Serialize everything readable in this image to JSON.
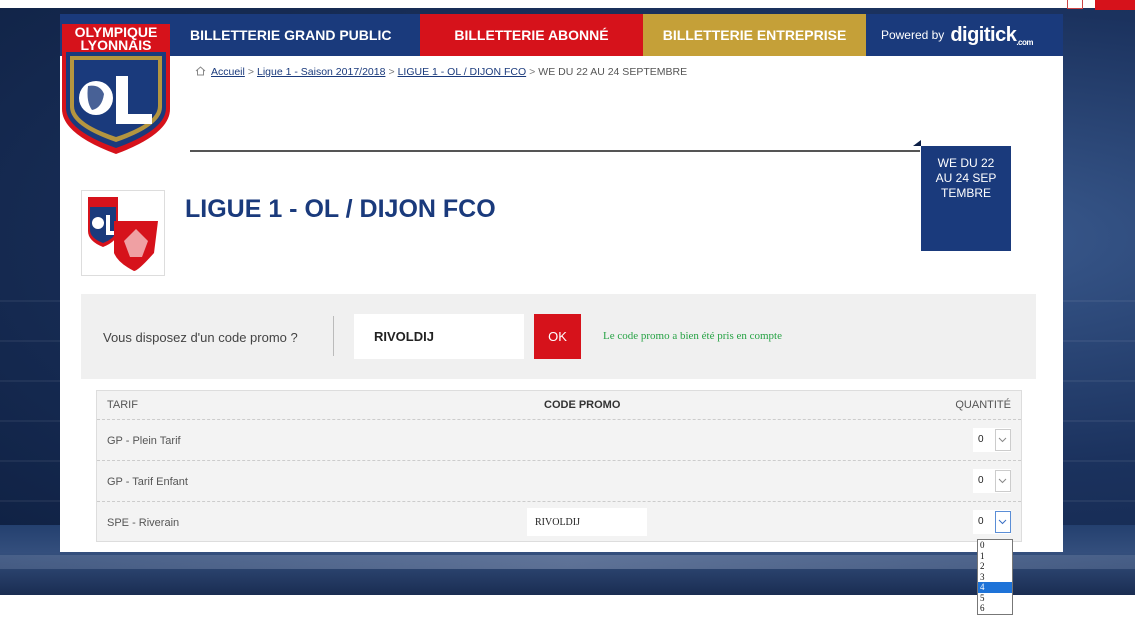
{
  "nav": {
    "tabs": [
      "BILLETTERIE GRAND PUBLIC",
      "BILLETTERIE ABONNÉ",
      "BILLETTERIE ENTREPRISE"
    ],
    "powered_by": "Powered by",
    "brand": "digitick",
    "brand_suffix": ".com"
  },
  "logo": {
    "line1": "OLYMPIQUE",
    "line2": "LYONNAIS"
  },
  "breadcrumb": {
    "items": [
      "Accueil",
      "Ligue 1 - Saison 2017/2018",
      "LIGUE 1 - OL / DIJON FCO"
    ],
    "current": "WE DU 22 AU 24 SEPTEMBRE"
  },
  "date_badge": "WE DU 22 AU 24 SEPTEMBRE",
  "match": {
    "title": "LIGUE 1 - OL / DIJON FCO"
  },
  "promo": {
    "question": "Vous disposez d'un code promo ?",
    "value": "RIVOLDIJ",
    "ok_label": "OK",
    "message": "Le code promo a bien été pris en compte"
  },
  "table": {
    "headers": [
      "TARIF",
      "CODE PROMO",
      "QUANTITÉ"
    ],
    "rows": [
      {
        "label": "GP - Plein Tarif",
        "code": "",
        "qty": "0"
      },
      {
        "label": "GP - Tarif Enfant",
        "code": "",
        "qty": "0"
      },
      {
        "label": "SPE - Riverain",
        "code": "RIVOLDIJ",
        "qty": "0"
      }
    ]
  },
  "dropdown": {
    "options": [
      "0",
      "1",
      "2",
      "3",
      "4",
      "5",
      "6"
    ],
    "highlighted": "4"
  },
  "colors": {
    "navy": "#1a3a7c",
    "red": "#d6121b",
    "gold": "#c5a038",
    "success": "#26a244"
  }
}
